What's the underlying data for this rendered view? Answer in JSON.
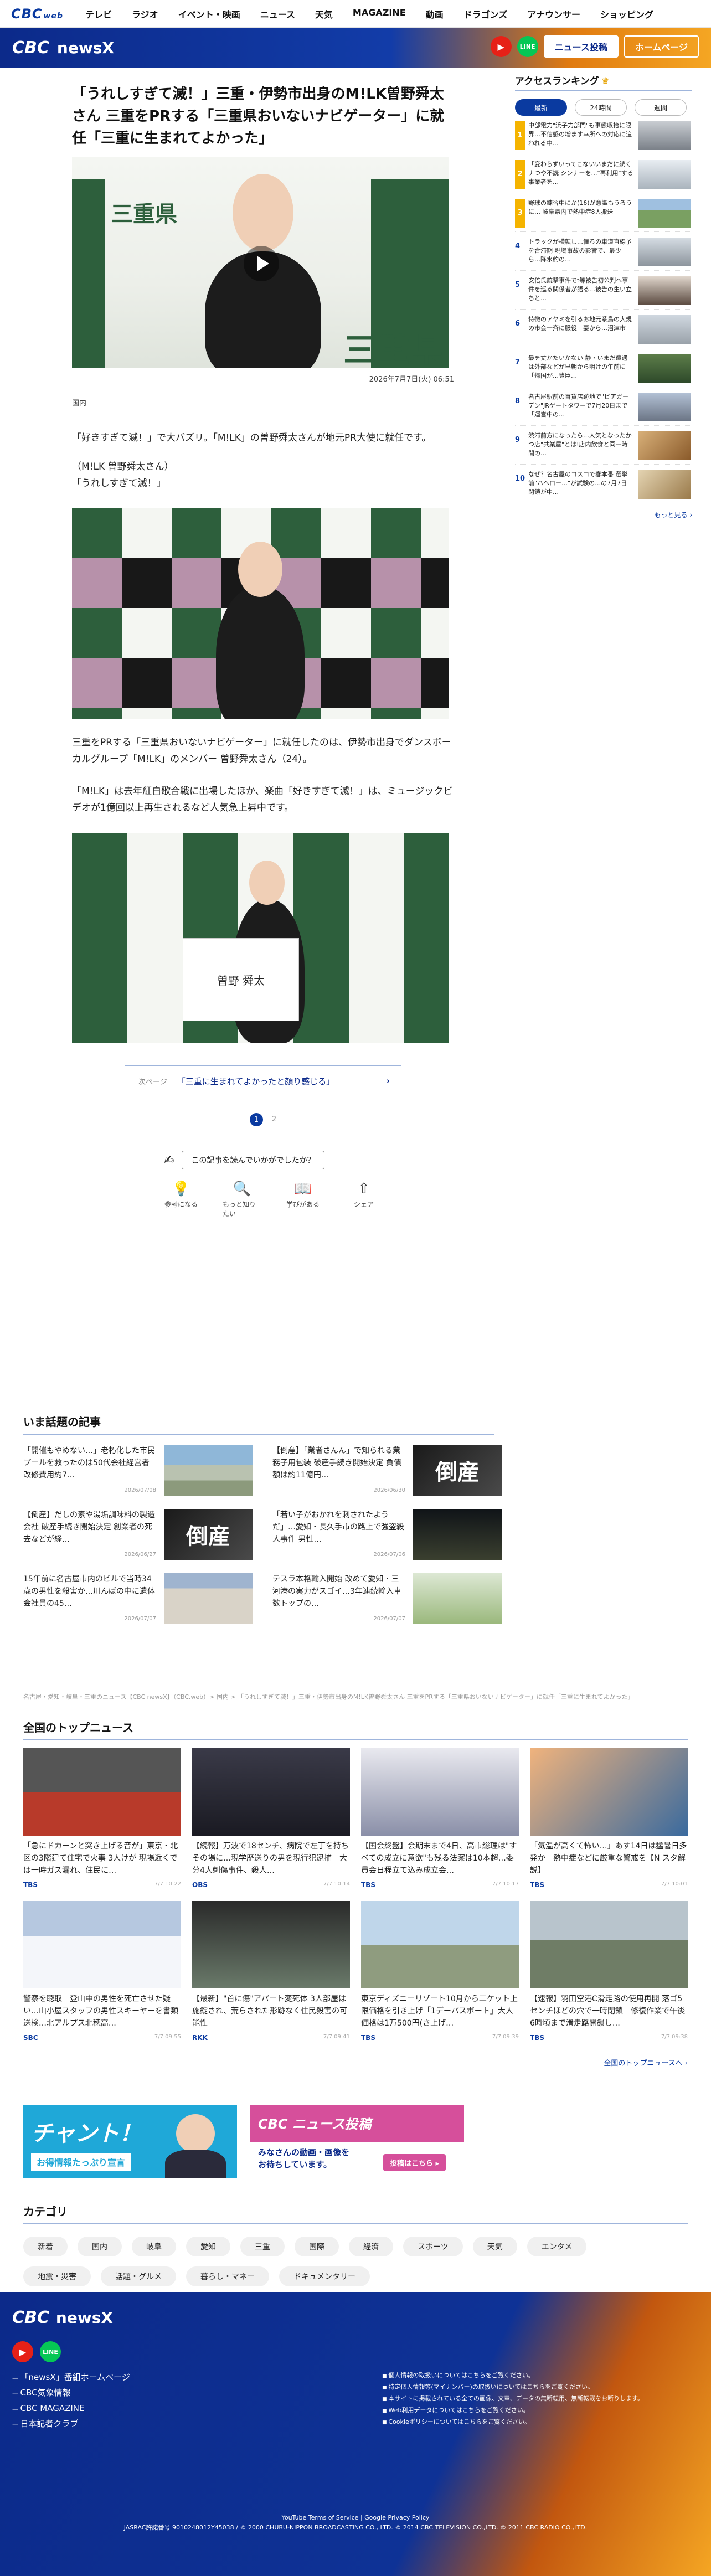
{
  "global_nav": {
    "brand": "CBC",
    "brand_sub": "web",
    "items": [
      "テレビ",
      "ラジオ",
      "イベント・映画",
      "ニュース",
      "天気",
      "MAGAZINE",
      "動画",
      "ドラゴンズ",
      "アナウンサー",
      "ショッピング"
    ]
  },
  "site": {
    "logo": "CBC",
    "name": "newsX",
    "post_button": "ニュース投稿",
    "home_button": "ホームページ"
  },
  "article": {
    "title": "「うれしすぎて滅！」三重・伊勢市出身のM!LK曽野舜太さん 三重をPRする「三重県おいないナビゲーター」に就任「三重に生まれてよかった」",
    "date": "2026年7月7日(火) 06:51",
    "category": "国内",
    "paragraphs": [
      "「好きすぎて滅！」で大バズリ。「M!LK」の曽野舜太さんが地元PR大使に就任です。",
      "（M!LK 曽野舜太さん）",
      "「うれしすぎて滅！」",
      "三重をPRする「三重県おいないナビゲーター」に就任したのは、伊勢市出身でダンスボーカルグループ「M!LK」のメンバー 曽野舜太さん（24）。",
      "「M!LK」は去年紅白歌合戦に出場したほか、楽曲「好きすぎて滅！」は、ミュージックビデオが1億回以上再生されるなど人気急上昇中です。"
    ],
    "photo_sign": "三重県",
    "board_name": "曽野 舜太",
    "next_label": "次ページ",
    "next_title": "「三重に生まれてよかったと顔り感じる」",
    "pages": [
      "1",
      "2"
    ],
    "feedback_q": "この記事を読んでいかがでしたか？",
    "reactions": [
      {
        "label": "参考になる",
        "icon": "💡"
      },
      {
        "label": "もっと知りたい",
        "icon": "🔍"
      },
      {
        "label": "学びがある",
        "icon": "📖"
      },
      {
        "label": "シェア",
        "icon": "⇧"
      }
    ]
  },
  "popular": {
    "heading": "いま話題の記事",
    "items": [
      {
        "title": "「開催もやめない…」老朽化した市民プールを救ったのは50代会社経営者 改修費用約7…",
        "date": "2026/07/08",
        "thumb": "pool"
      },
      {
        "title": "【倒産】「業者さんん」で知られる業務子用包装 破産手続き開始決定 負債額は約11億円…",
        "date": "2026/06/30",
        "thumb": "bankrupt"
      },
      {
        "title": "【倒産】だしの素や湯垢調味料の製造会社 破産手続き開始決定 創業者の死去などが経…",
        "date": "2026/06/27",
        "thumb": "bankrupt"
      },
      {
        "title": "「若い子がおかれを刺されたようだ」…愛知・長久手市の路上で強盗殺人事件 男性…",
        "date": "2026/07/06",
        "thumb": "night"
      },
      {
        "title": "15年前に名古屋市内のビルで当時34歳の男性を殺害か…川んばの中に遺体 会社員の45…",
        "date": "2026/07/07",
        "thumb": "building"
      },
      {
        "title": "テスラ本格輸入開始 改めて愛知・三河港の実力がスゴイ…3年連続輸入車数トップの…",
        "date": "2026/07/07",
        "thumb": "port"
      }
    ]
  },
  "breadcrumb": "名古屋・愛知・岐阜・三重のニュース【CBC newsX】（CBC.web）> 国内 > 「うれしすぎて滅！」三重・伊勢市出身のM!LK曽野舜太さん 三重をPRする「三重県おいないナビゲーター」に就任「三重に生まれてよかった」",
  "top_news": {
    "heading": "全国のトップニュース",
    "more": "全国のトップニュースへ ›",
    "items": [
      {
        "title": "「急にドカーンと突き上げる音が」東京・北区の3階建て住宅で火事 3人けが 現場近くでは一時ガス漏れ、住民に…",
        "source": "TBS",
        "time": "7/7 10:22",
        "thumb": "fire"
      },
      {
        "title": "【続報】万波で18センチ、病院で左丁を持ちその場に…現学歴送りの男を現行犯逮捕　大分4人刺傷事件、殺人…",
        "source": "OBS",
        "time": "7/7 10:14",
        "thumb": "police"
      },
      {
        "title": "【国会終盤】会期末まで4日、高市総理は\"すべての成立に意欲\"も残る法案は10本超…委員会日程立て込み成立会…",
        "source": "TBS",
        "time": "7/7 10:17",
        "thumb": "diet"
      },
      {
        "title": "「気温が高くて怖い…」あす14日は猛暑日多発か　熱中症などに厳重な警戒を【N スタ解説】",
        "source": "TBS",
        "time": "7/7 10:01",
        "thumb": "heat"
      },
      {
        "title": "警察を聴取　登山中の男性を死亡させた疑い…山小屋スタッフの男性スキーヤーを書類送検…北アルプス北穂高…",
        "source": "SBC",
        "time": "7/7 09:55",
        "thumb": "snow"
      },
      {
        "title": "【最新】\"首に傷\"アパート変死体 3人部屋は施錠され、荒らされた形跡なく住民殺害の可能性",
        "source": "RKK",
        "time": "7/7 09:41",
        "thumb": "apt"
      },
      {
        "title": "東京ディズニーリゾート10月から二ケット上限価格を引き上げ「1デーパスポート」大人価格は1万500円(さ上げ…",
        "source": "TBS",
        "time": "7/7 09:39",
        "thumb": "castle"
      },
      {
        "title": "【速報】羽田空港C滑走路の使用再開 落ゴ5センチほどの穴で一時閉鎖　修復作業で午後6時頃まで滑走路開鎖し…",
        "source": "TBS",
        "time": "7/7 09:38",
        "thumb": "airport"
      }
    ]
  },
  "banners": {
    "b1_big": "チャント！",
    "b1_sub": "お得情報たっぷり宣言",
    "b2_logo": "CBC ニュース投稿",
    "b2_text": "みなさんの動画・画像を\nお待ちしています。",
    "b2_btn": "投稿はこちら ▸"
  },
  "categories": {
    "heading": "カテゴリ",
    "items": [
      "新着",
      "国内",
      "岐阜",
      "愛知",
      "三重",
      "国際",
      "経済",
      "スポーツ",
      "天気",
      "エンタメ",
      "地震・災害",
      "話題・グルメ",
      "暮らし・マネー",
      "ドキュメンタリー"
    ]
  },
  "sidebar": {
    "heading": "アクセスランキング",
    "tabs": [
      "最新",
      "24時間",
      "週間"
    ],
    "items": [
      {
        "rank": "1",
        "title": "中部電力\"浜子力部門\"も事態収拾に限界…不信感の増ます幸所への対応に追われる中…",
        "thumb": "crowd"
      },
      {
        "rank": "2",
        "title": "「変わらずいってこないいまだに続くナつや不読 シンナーを…\"再利用\"する事業者を…",
        "thumb": "snowroad"
      },
      {
        "rank": "3",
        "title": "野球の練習中にか(16)が意識もうろうに… 岐阜県内で熱中症8人搬送",
        "thumb": "field"
      },
      {
        "rank": "4",
        "title": "トラックが横転し…僅ろの車道直線予を合滞期 現場事故の影響で、最少ら…降水約の…",
        "thumb": "truck"
      },
      {
        "rank": "5",
        "title": "安倍氏銃撃事件でt等被告初公判へ事件を巡る関係者が語る…被告の生い立ちと…",
        "thumb": "person"
      },
      {
        "rank": "6",
        "title": "特徴のアヤミを引るお地元系鳥の大規の市会一斉に服役　妻から…沼津市",
        "thumb": "road"
      },
      {
        "rank": "7",
        "title": "最を丈かたいかない 静・いまだ遭遇は外部などが早朝から明けの午前に「帰国が…豊臣…",
        "thumb": "green"
      },
      {
        "rank": "8",
        "title": "名古屋駅前の百貨店跡地で\"ビアガーデン\"JRゲートタワーで7月20日まで「運営中の…",
        "thumb": "city"
      },
      {
        "rank": "9",
        "title": "渋滞前方になったら…人気となったかつ店\"共業屋\"とは!店内飲食と同一時間の…",
        "thumb": "food"
      },
      {
        "rank": "10",
        "title": "なぜ？名古屋のコスコで春本番 選挙前\"ハヘロー…\"が試験の…の7月7日 閉鎖が中…",
        "thumb": "food2"
      }
    ],
    "more": "もっと見る ›"
  },
  "footer": {
    "logo": "CBC",
    "name": "newsX",
    "links": [
      "「newsX」番組ホームページ",
      "CBC気象情報",
      "CBC MAGAZINE",
      "日本記者クラブ"
    ],
    "notices": [
      "個人情報の取扱いについてはこちらをご覧ください。",
      "特定個人情報等(マイナンバー)の取扱いについてはこちらをご覧ください。",
      "本サイトに掲載されている全ての画像、文章、データの無断転用、無断転載をお断りします。",
      "Web利用データについてはこちらをご覧ください。",
      "Cookieポリシーについてはこちらをご覧ください。"
    ],
    "policy": "YouTube Terms of Service  |  Google Privacy Policy",
    "jasrac": "JASRAC許諾番号 9010248012Y45038 / © 2000 CHUBU-NIPPON BROADCASTING CO., LTD. © 2014 CBC TELEVISION CO.,LTD. © 2011 CBC RADIO CO.,LTD."
  },
  "colors": {
    "brand_blue": "#0a3aa0",
    "orange": "#f5a623",
    "youtube": "#e62117",
    "line": "#06c755"
  }
}
